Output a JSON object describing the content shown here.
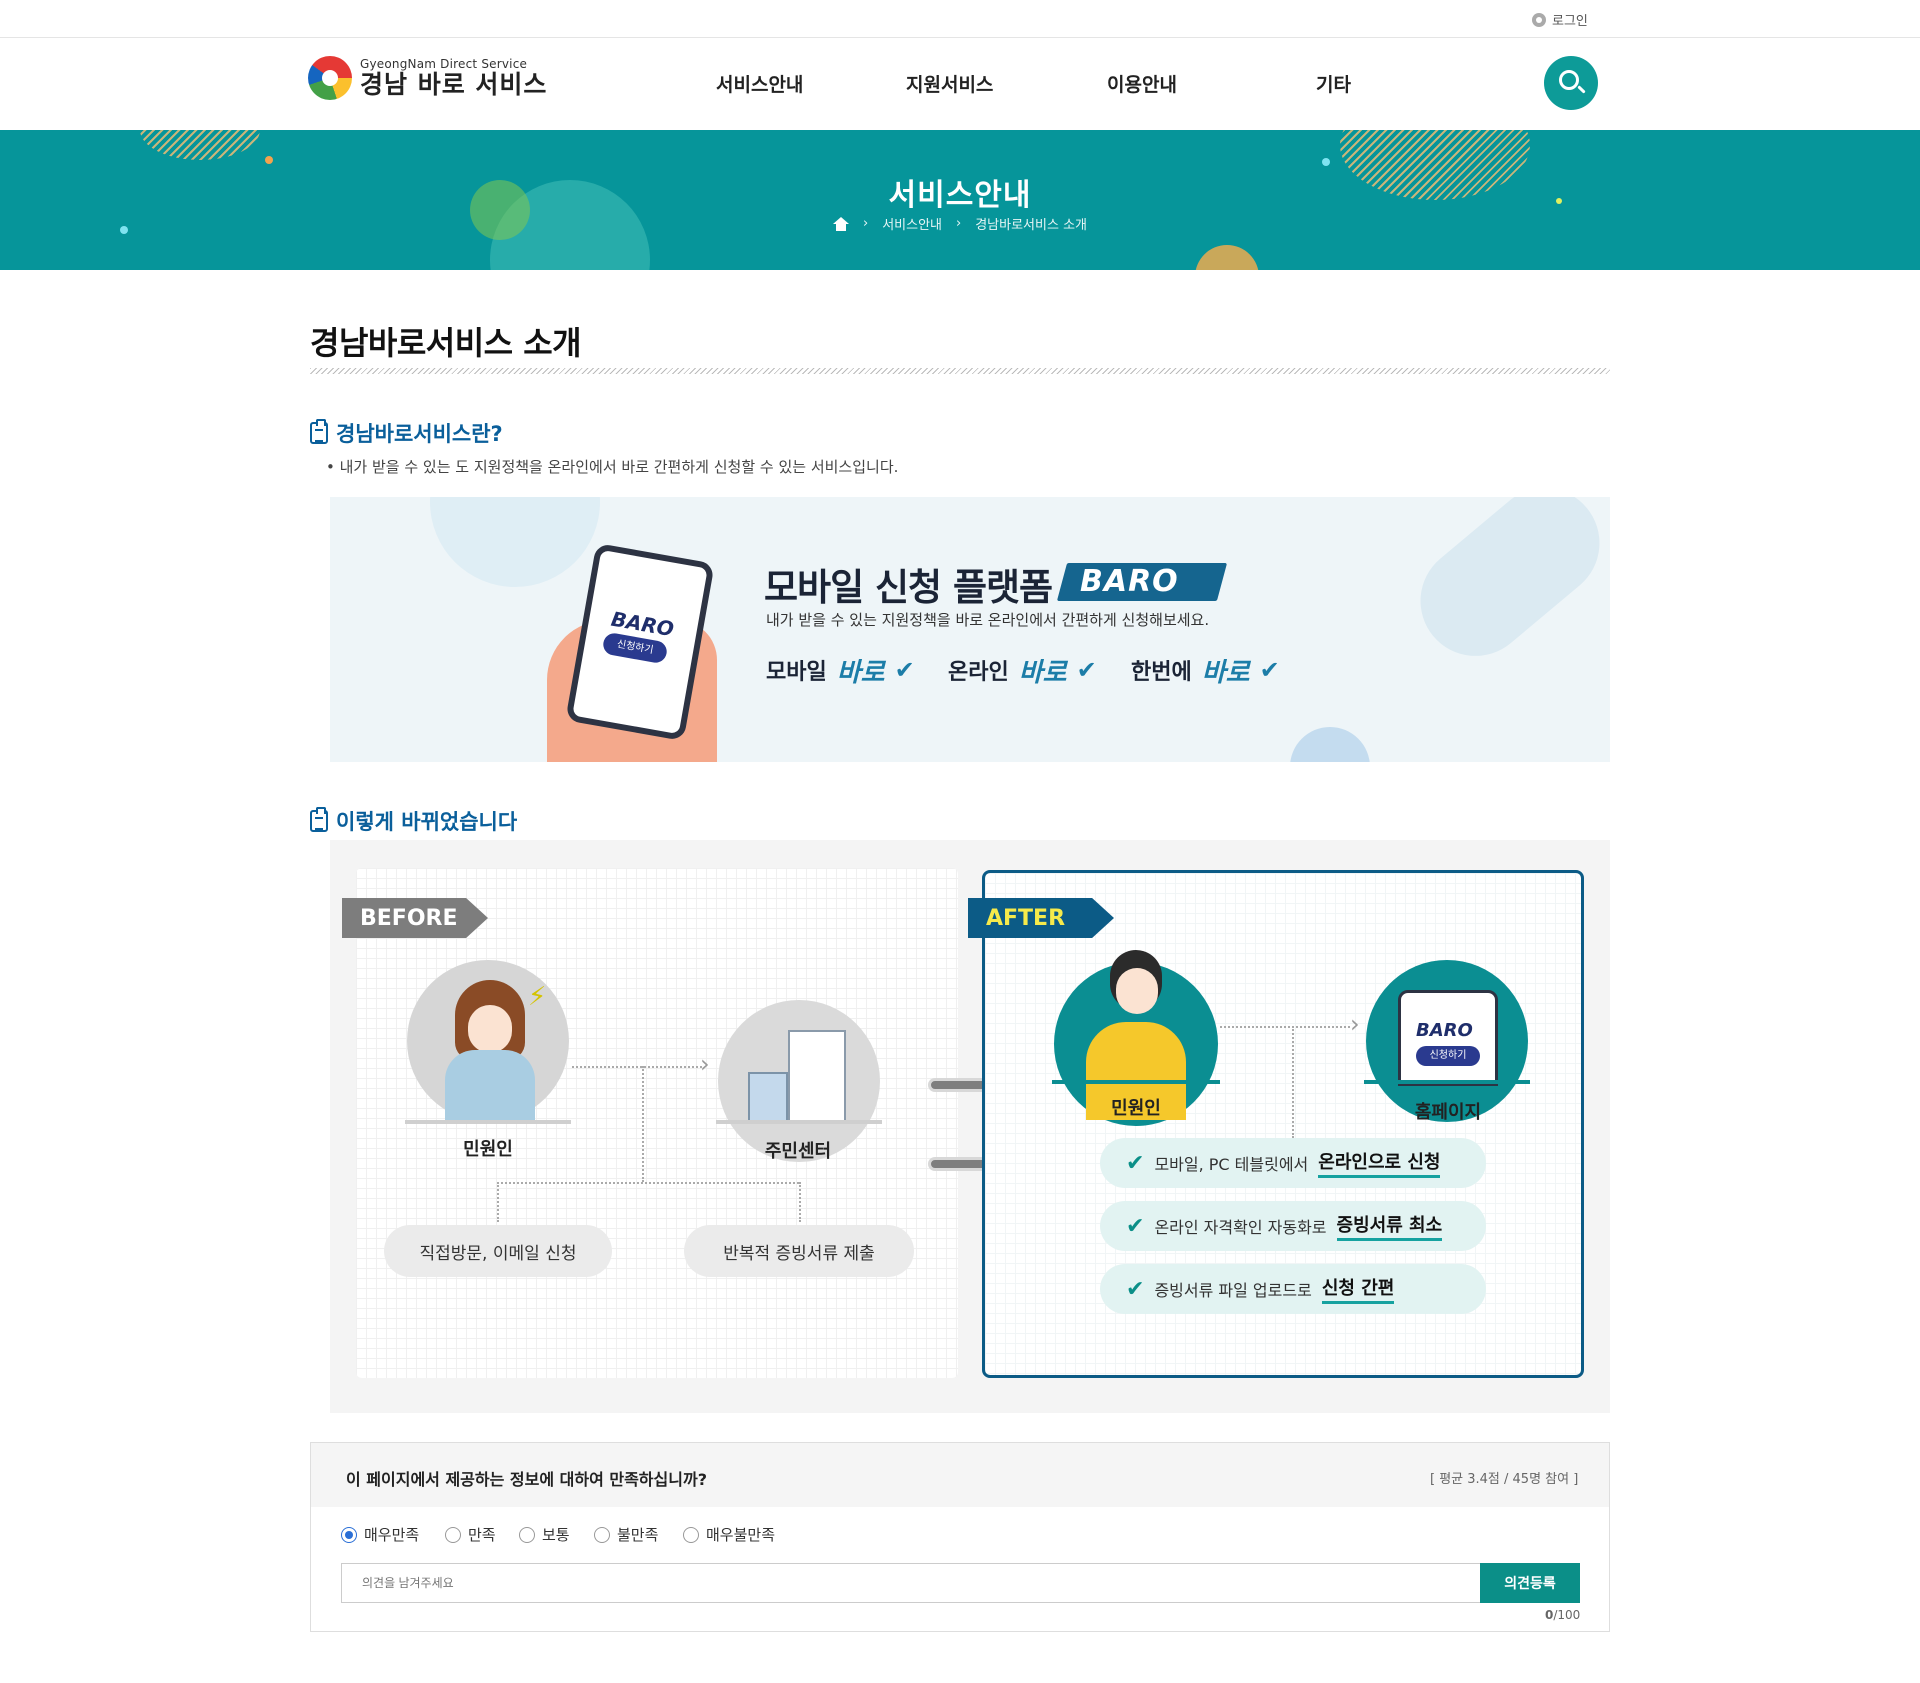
{
  "topbar": {
    "login_label": "로그인"
  },
  "header": {
    "logo_sub": "GyeongNam Direct Service",
    "logo_title": "경남 바로 서비스",
    "nav": [
      "서비스안내",
      "지원서비스",
      "이용안내",
      "기타"
    ]
  },
  "banner": {
    "title": "서비스안내",
    "breadcrumb": [
      "서비스안내",
      "경남바로서비스 소개"
    ]
  },
  "page": {
    "title": "경남바로서비스 소개"
  },
  "section1": {
    "heading": "경남바로서비스란?",
    "text": "• 내가 받을 수 있는 도 지원정책을 온라인에서 바로 간편하게 신청할 수 있는 서비스입니다."
  },
  "promo": {
    "title": "모바일 신청 플랫폼",
    "tag": "BARO",
    "desc": "내가 받을 수 있는 지원정책을 바로 온라인에서 간편하게 신청해보세요.",
    "chips": [
      {
        "label": "모바일",
        "baro": "바로"
      },
      {
        "label": "온라인",
        "baro": "바로"
      },
      {
        "label": "한번에",
        "baro": "바로"
      }
    ],
    "phone_text": "BARO",
    "phone_button": "신청하기"
  },
  "section2": {
    "heading": "이렇게 바뀌었습니다"
  },
  "before": {
    "ribbon": "BEFORE",
    "person": "민원인",
    "center": "주민센터",
    "pill1": "직접방문, 이메일 신청",
    "pill2": "반복적 증빙서류 제출"
  },
  "after": {
    "ribbon": "AFTER",
    "person": "민원인",
    "homepage": "홈페이지",
    "screen_text": "BARO",
    "screen_button": "신청하기",
    "benefits": [
      {
        "pre": "모바일, PC 테블릿에서 ",
        "strong": "온라인으로 신청"
      },
      {
        "pre": "온라인 자격확인 자동화로 ",
        "strong": "증빙서류 최소"
      },
      {
        "pre": "증빙서류 파일 업로드로 ",
        "strong": "신청 간편"
      }
    ]
  },
  "survey": {
    "question": "이 페이지에서 제공하는 정보에 대하여 만족하십니까?",
    "stat": "[ 평균 3.4점 / 45명 참여 ]",
    "options": [
      "매우만족",
      "만족",
      "보통",
      "불만족",
      "매우불만족"
    ],
    "selected": "매우만족",
    "placeholder": "의견을 남겨주세요",
    "submit_label": "의견등록",
    "count": "0",
    "max": "/100"
  },
  "colors": {
    "teal": "#06959a",
    "navy": "#0c5b86",
    "accent": "#0b8f88"
  }
}
